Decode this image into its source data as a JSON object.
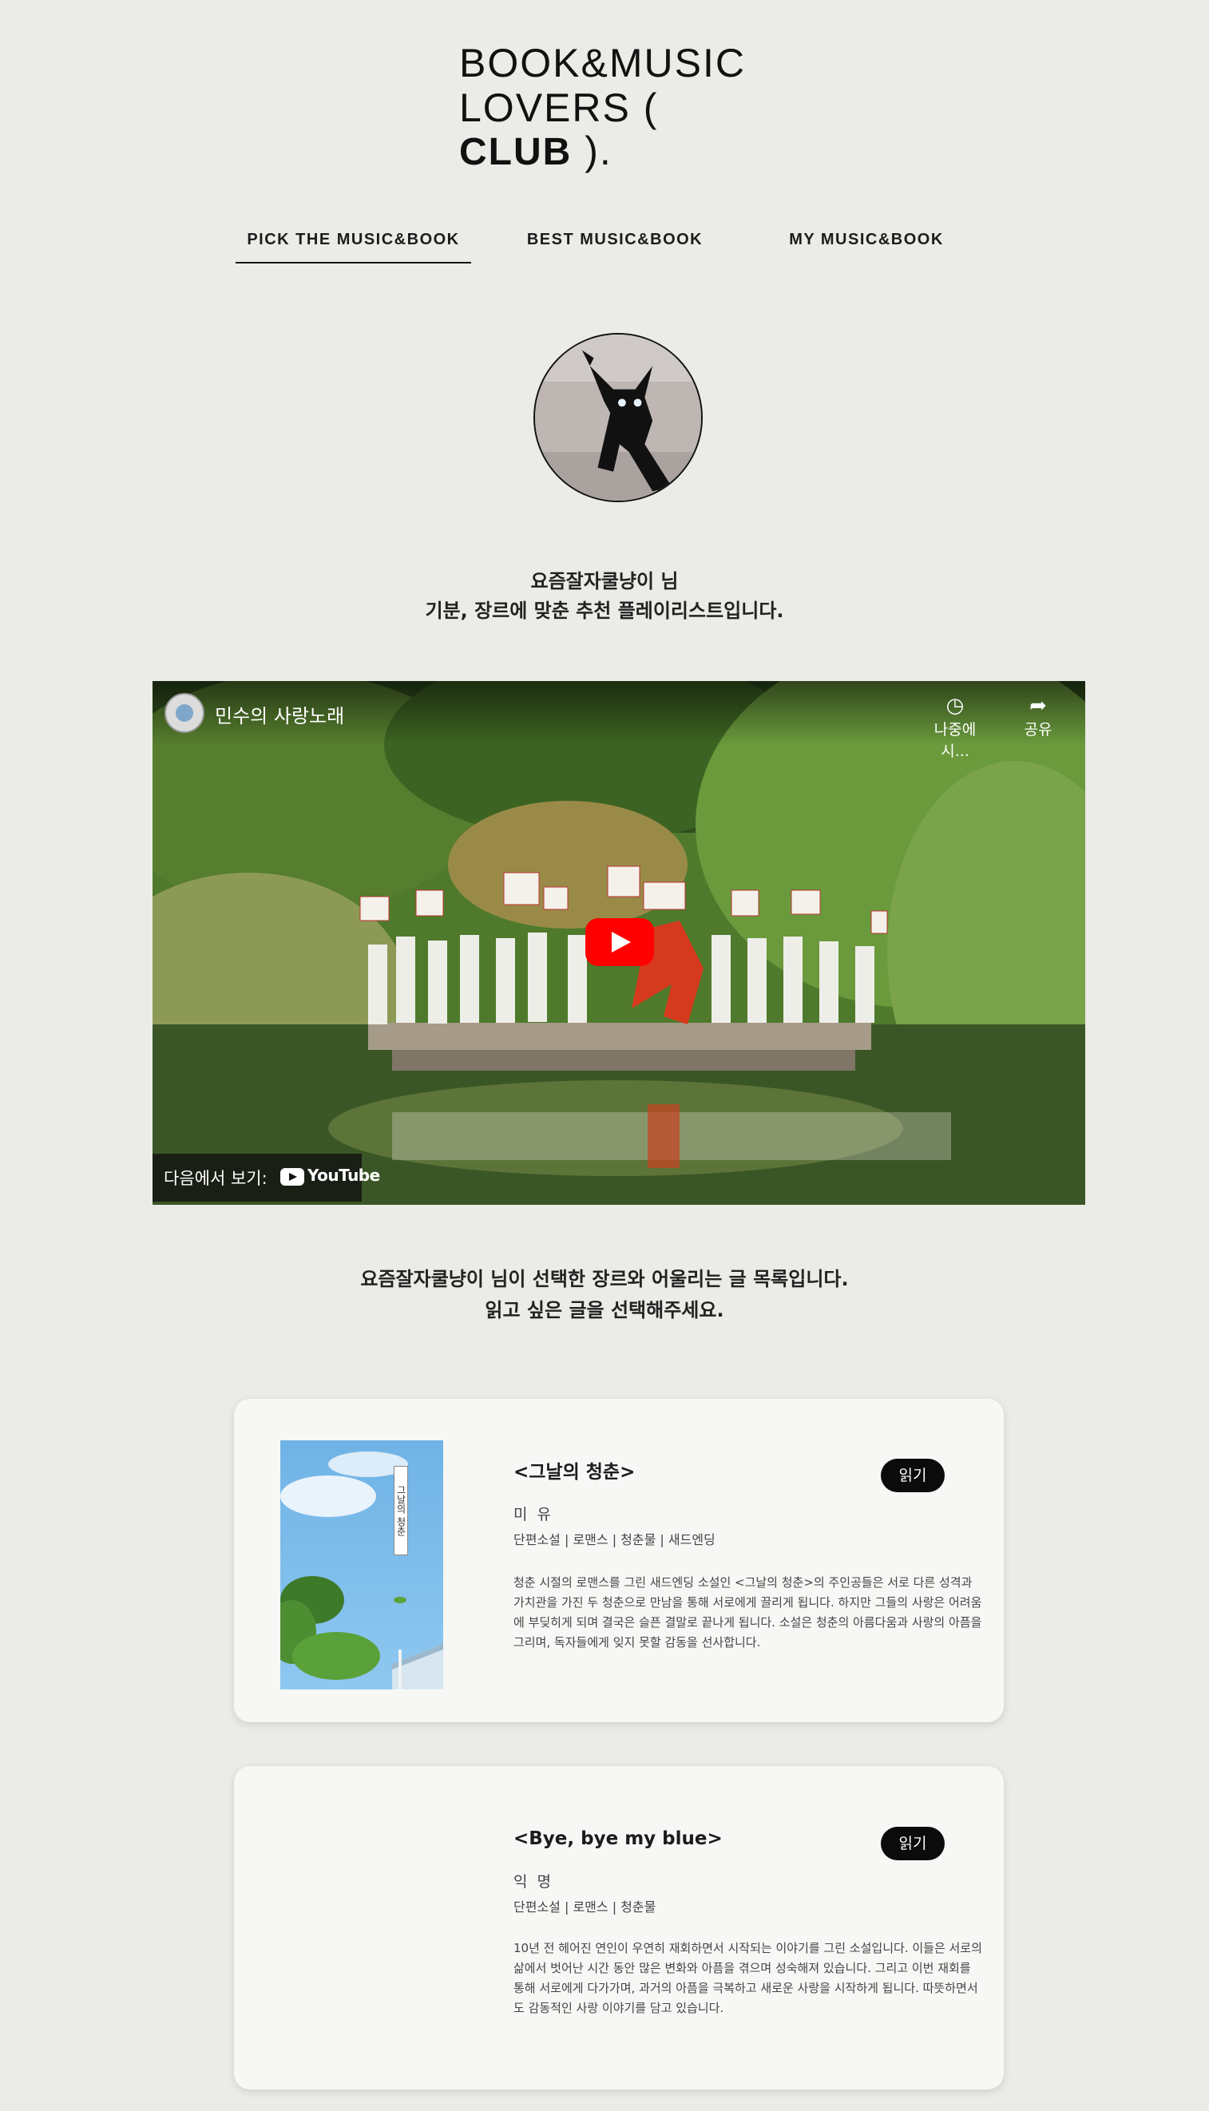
{
  "brand": {
    "logo_line1": "BOOK&MUSIC",
    "logo_line2_pre": "LOVERS",
    "logo_line2_bold": "CLUB"
  },
  "nav": {
    "items": [
      {
        "label": "PICK THE MUSIC&BOOK",
        "active": true
      },
      {
        "label": "BEST MUSIC&BOOK",
        "active": false
      },
      {
        "label": "MY MUSIC&BOOK",
        "active": false
      }
    ]
  },
  "profile": {
    "greeting_line1": "요즘잘자쿨냥이 님",
    "greeting_line2": "기분, 장르에 맞춘 추천 플레이리스트입니다."
  },
  "video": {
    "title": "민수의 사랑노래",
    "watch_later": "나중에 시...",
    "share": "공유",
    "watch_on": "다음에서 보기:",
    "youtube": "YouTube",
    "watch_later_icon": "clock-icon",
    "share_icon": "share-icon"
  },
  "list": {
    "intro_line1": "요즘잘자쿨냥이 님이 선택한 장르와 어울리는 글 목록입니다.",
    "intro_line2": "읽고 싶은 글을 선택해주세요."
  },
  "books": [
    {
      "title": "<그날의 청춘>",
      "author": "미 유",
      "tags": "단편소설 | 로맨스 | 청춘물 | 새드엔딩",
      "summary": "청춘 시절의 로맨스를 그린 새드엔딩 소설인 <그날의 청춘>의 주인공들은 서로 다른 성격과 가치관을 가진 두 청춘으로 만남을 통해 서로에게 끌리게 됩니다. 하지만 그들의 사랑은 어려움에 부딪히게 되며 결국은 슬픈 결말로 끝나게 됩니다. 소설은 청춘의 아름다움과 사랑의 아픔을 그리며, 독자들에게 잊지 못할 감동을 선사합니다.",
      "read_label": "읽기",
      "cover_text": "그날의 청춘"
    },
    {
      "title": "<Bye, bye my blue>",
      "author": "익 명",
      "tags": "단편소설 | 로맨스 | 청춘물",
      "summary": "10년 전 헤어진 연인이 우연히 재회하면서 시작되는 이야기를 그린 소설입니다. 이들은 서로의 삶에서 벗어난 시간 동안 많은 변화와 아픔을 겪으며 성숙해져 있습니다. 그리고 이번 재회를 통해 서로에게 다가가며, 과거의 아픔을 극복하고 새로운 사랑을 시작하게 됩니다. 따뜻하면서도 감동적인 사랑 이야기를 담고 있습니다.",
      "read_label": "읽기"
    }
  ]
}
